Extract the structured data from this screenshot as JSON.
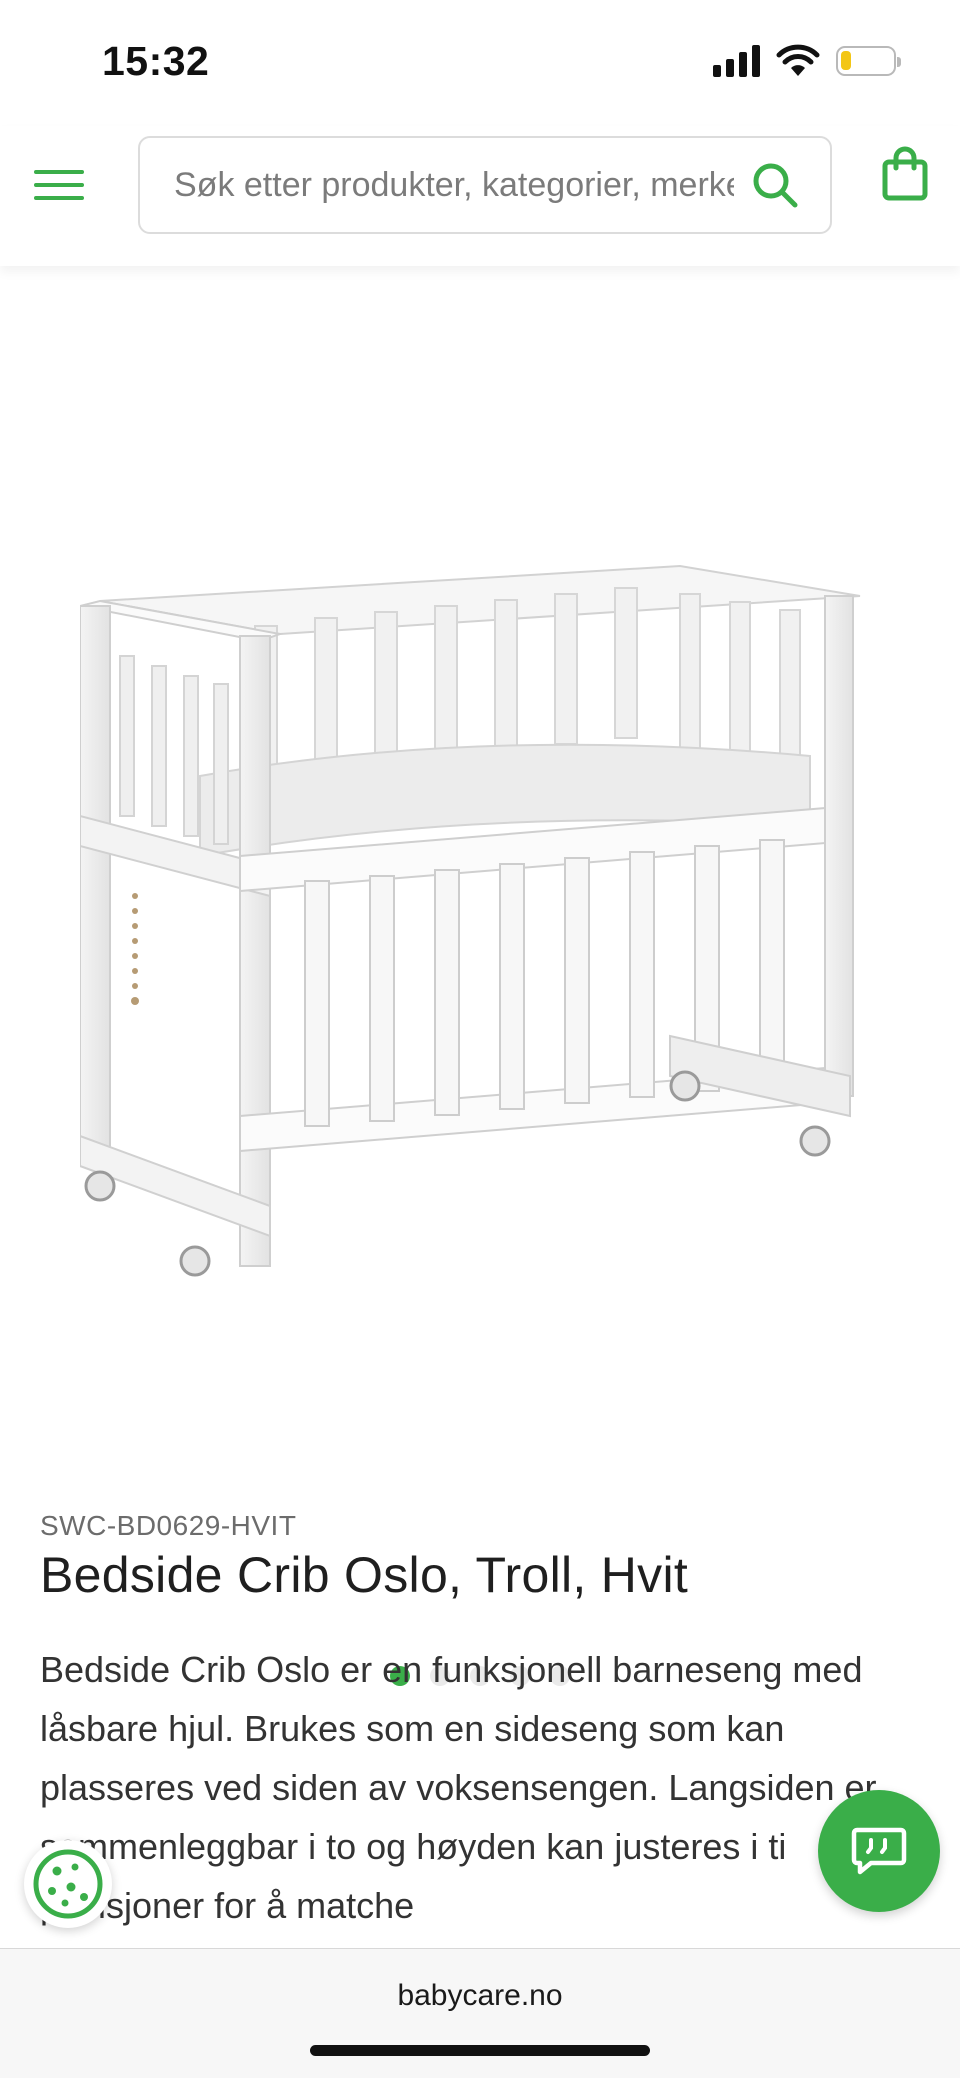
{
  "status_bar": {
    "time": "15:32",
    "battery_level": 0.2
  },
  "header": {
    "menu_icon": "hamburger-menu-icon",
    "search": {
      "placeholder": "Søk etter produkter, kategorier, merker",
      "value": ""
    },
    "cart_icon": "shopping-bag-icon"
  },
  "gallery": {
    "image_alt": "Bedside Crib Oslo, Troll, Hvit",
    "total_images": 5,
    "active_index": 0
  },
  "product": {
    "sku": "SWC-BD0629-HVIT",
    "title": "Bedside Crib Oslo, Troll, Hvit",
    "description": "Bedside Crib Oslo er en funksjonell barneseng med låsbare hjul. Brukes som en sideseng som kan plasseres ved siden av voksensengen. Langsiden er sammenleggbar i to og høyden kan justeres i ti posisjoner for å matche"
  },
  "floating": {
    "cookie_icon": "cookie-icon",
    "chat_icon": "chat-icon"
  },
  "browser": {
    "url": "babycare.no"
  },
  "colors": {
    "accent": "#3aae49",
    "text": "#2e2e2e",
    "muted": "#6c6c6c"
  }
}
